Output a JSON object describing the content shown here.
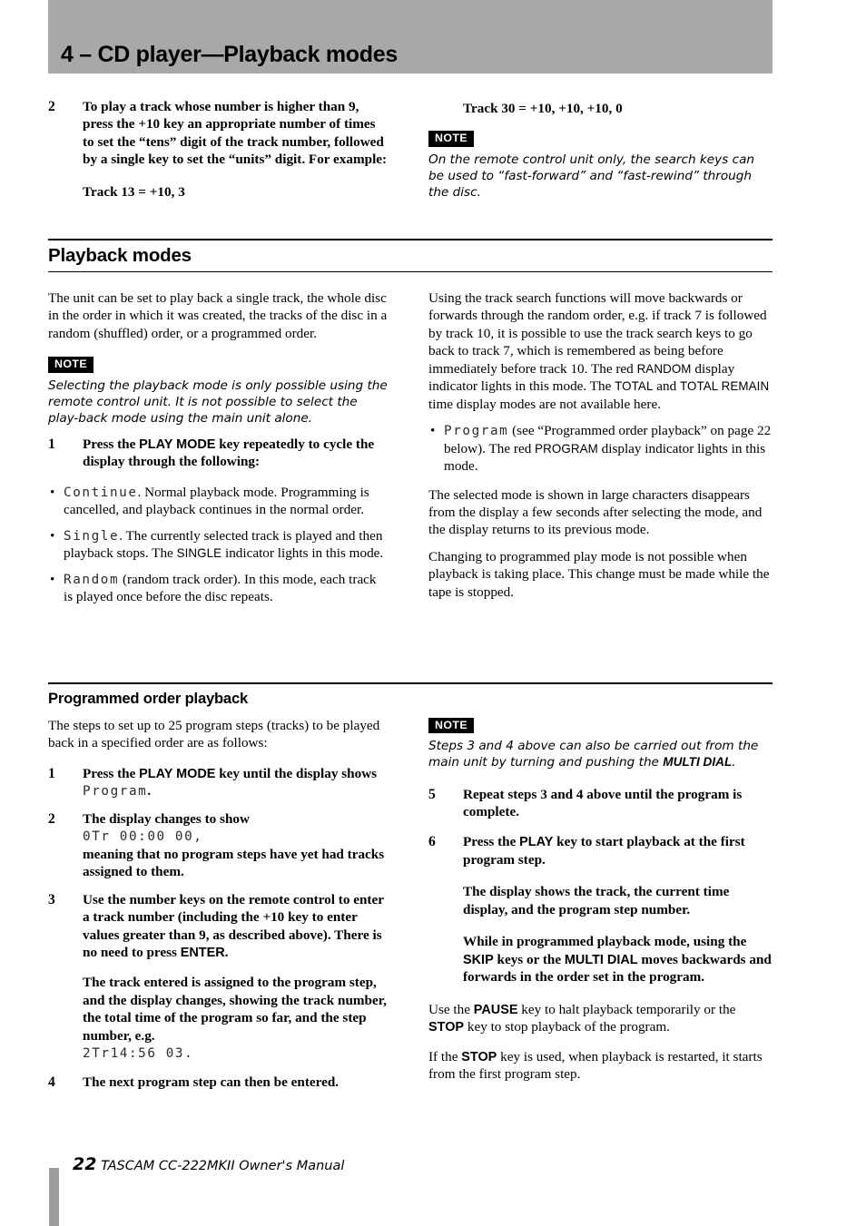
{
  "header": {
    "title": "4 – CD player—Playback modes"
  },
  "top_left": {
    "step2_num": "2",
    "step2_text": "To play a track whose number is higher than 9, press the +10 key an appropriate number of times to set the “tens” digit of the track number, followed by a single key to set the “units” digit. For example:",
    "example": "Track 13 = +10, 3"
  },
  "top_right": {
    "example": "Track 30 = +10, +10, +10, 0",
    "note_tag": "NOTE",
    "note_text": "On the remote control unit only, the search keys can be used to “fast-forward” and “fast-rewind” through the disc."
  },
  "playback_modes": {
    "heading": "Playback modes",
    "intro": "The unit can be set to play back a single track, the whole disc in the order in which it was created, the tracks of the disc in a random (shuffled) order, or a programmed order.",
    "note_tag": "NOTE",
    "note_text": "Selecting the playback mode is only possible using the remote control unit. It is not possible to select the play-back mode using the main unit alone.",
    "step1_num": "1",
    "step1_pre": "Press the ",
    "step1_key": "PLAY MODE",
    "step1_post": " key repeatedly to cycle the display through the following:",
    "bullets": [
      {
        "lcd": "Continue",
        "text": ". Normal playback mode. Programming is cancelled, and playback continues in the normal order."
      },
      {
        "lcd": "Single",
        "pre": ". The currently selected track is played and then playback stops. The ",
        "indicator": "SINGLE",
        "post": " indicator lights in this mode."
      },
      {
        "lcd": "Random",
        "text": " (random track order). In this mode, each track is played once before the disc repeats."
      }
    ],
    "right_para_1a": "Using the track search functions will move backwards or forwards through the random order, e.g. if track 7 is followed by track 10, it is possible to use the track search keys to go back to track 7, which is remembered as being before immediately before track 10. The red ",
    "right_para_1_ind1": "RANDOM",
    "right_para_1b": " display indicator lights in this mode. The ",
    "right_para_1_ind2": "TOTAL",
    "right_para_1c": " and ",
    "right_para_1_ind3": "TOTAL REMAIN",
    "right_para_1d": " time display modes are not available here.",
    "program_bullet_lcd": "Program",
    "program_bullet_a": " (see “Programmed order playback” on page 22 below). The red ",
    "program_bullet_ind": "PROGRAM",
    "program_bullet_b": " display indicator lights in this mode.",
    "right_para_2": "The selected mode is shown in large characters disappears from the display a few seconds after selecting the mode, and the display returns to its previous mode.",
    "right_para_3": "Changing to programmed play mode is not possible when playback is taking place. This change must be made while the tape is stopped."
  },
  "programmed_order": {
    "heading": "Programmed order playback",
    "intro": "The steps to set up to 25 program steps (tracks) to be played back in a specified order are as follows:",
    "step1_num": "1",
    "step1_pre": "Press the ",
    "step1_key": "PLAY MODE",
    "step1_mid": " key until the display shows ",
    "step1_lcd": "Program",
    "step1_post": ".",
    "step2_num": "2",
    "step2_text": "The display changes to show",
    "step2_lcd": "0Tr 00:00  00,",
    "step2_text2": "meaning that no program steps have yet had tracks assigned to them.",
    "step3_num": "3",
    "step3_pre": "Use the number keys on the remote control to enter a track number (including the +10 key to enter values greater than 9, as described above). There is no need to press ",
    "step3_key": "ENTER",
    "step3_post": ".",
    "step3_cont": "The track entered is assigned to the program step, and the display changes, showing the track number, the total time of the program so far, and the step number, e.g.",
    "step3_lcd": "2Tr14:56  03.",
    "step4_num": "4",
    "step4_text": "The next program step can then be entered.",
    "note_tag": "NOTE",
    "note_pre": "Steps 3 and 4 above can also be carried out from the main unit by turning and pushing the ",
    "note_key": "MULTI DIAL",
    "note_post": ".",
    "step5_num": "5",
    "step5_text": "Repeat steps 3 and 4 above until the program is complete.",
    "step6_num": "6",
    "step6_pre": "Press the ",
    "step6_key": "PLAY",
    "step6_post": " key to start playback at the first program step.",
    "step6_cont1": "The display shows the track, the current time display, and the program step number.",
    "step6_cont2_a": "While in programmed playback mode, using the ",
    "step6_cont2_key1": "SKIP",
    "step6_cont2_b": " keys or the ",
    "step6_cont2_key2": "MULTI DIAL",
    "step6_cont2_c": " moves backwards and forwards in the order set in the program.",
    "para_pause_a": "Use the ",
    "para_pause_key1": "PAUSE",
    "para_pause_b": " key to halt playback temporarily or the ",
    "para_pause_key2": "STOP",
    "para_pause_c": " key to stop playback of the program.",
    "para_stop_a": "If the ",
    "para_stop_key": "STOP",
    "para_stop_b": " key is used, when playback is restarted, it starts from the first program step."
  },
  "footer": {
    "page_number": "22",
    "manual_title": "TASCAM CC-222MKII Owner's Manual"
  }
}
